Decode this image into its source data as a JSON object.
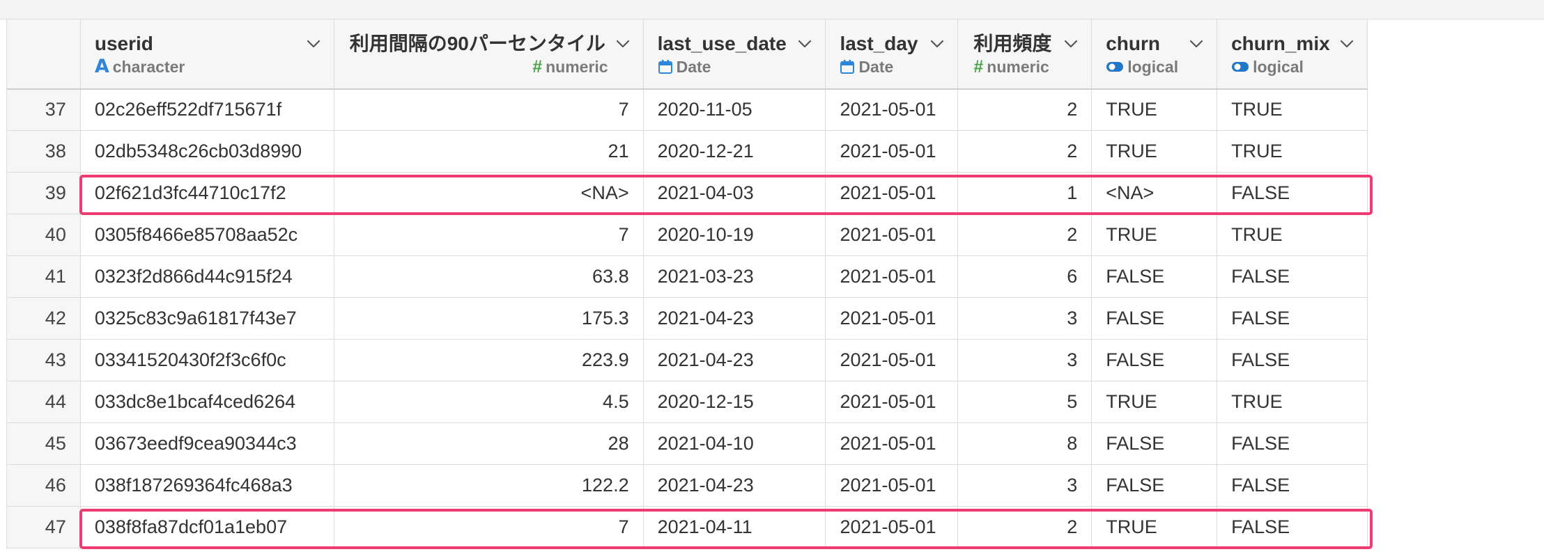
{
  "columns": [
    {
      "key": "rownum",
      "name": "",
      "type": ""
    },
    {
      "key": "userid",
      "name": "userid",
      "type": "character",
      "type_icon": "character-type-icon"
    },
    {
      "key": "interval_p90",
      "name": "利用間隔の90パーセンタイル",
      "type": "numeric",
      "type_icon": "numeric-type-icon"
    },
    {
      "key": "last_use_date",
      "name": "last_use_date",
      "type": "Date",
      "type_icon": "calendar-icon"
    },
    {
      "key": "last_day",
      "name": "last_day",
      "type": "Date",
      "type_icon": "calendar-icon"
    },
    {
      "key": "frequency",
      "name": "利用頻度",
      "type": "numeric",
      "type_icon": "numeric-type-icon"
    },
    {
      "key": "churn",
      "name": "churn",
      "type": "logical",
      "type_icon": "toggle-icon"
    },
    {
      "key": "churn_mix",
      "name": "churn_mix",
      "type": "logical",
      "type_icon": "toggle-icon"
    }
  ],
  "rows": [
    {
      "n": "37",
      "userid": "02c26eff522df715671f",
      "p90": "7",
      "last_use_date": "2020-11-05",
      "last_day": "2021-05-01",
      "freq": "2",
      "churn": "TRUE",
      "churn_mix": "TRUE"
    },
    {
      "n": "38",
      "userid": "02db5348c26cb03d8990",
      "p90": "21",
      "last_use_date": "2020-12-21",
      "last_day": "2021-05-01",
      "freq": "2",
      "churn": "TRUE",
      "churn_mix": "TRUE"
    },
    {
      "n": "39",
      "userid": "02f621d3fc44710c17f2",
      "p90": "<NA>",
      "last_use_date": "2021-04-03",
      "last_day": "2021-05-01",
      "freq": "1",
      "churn": "<NA>",
      "churn_mix": "FALSE"
    },
    {
      "n": "40",
      "userid": "0305f8466e85708aa52c",
      "p90": "7",
      "last_use_date": "2020-10-19",
      "last_day": "2021-05-01",
      "freq": "2",
      "churn": "TRUE",
      "churn_mix": "TRUE"
    },
    {
      "n": "41",
      "userid": "0323f2d866d44c915f24",
      "p90": "63.8",
      "last_use_date": "2021-03-23",
      "last_day": "2021-05-01",
      "freq": "6",
      "churn": "FALSE",
      "churn_mix": "FALSE"
    },
    {
      "n": "42",
      "userid": "0325c83c9a61817f43e7",
      "p90": "175.3",
      "last_use_date": "2021-04-23",
      "last_day": "2021-05-01",
      "freq": "3",
      "churn": "FALSE",
      "churn_mix": "FALSE"
    },
    {
      "n": "43",
      "userid": "03341520430f2f3c6f0c",
      "p90": "223.9",
      "last_use_date": "2021-04-23",
      "last_day": "2021-05-01",
      "freq": "3",
      "churn": "FALSE",
      "churn_mix": "FALSE"
    },
    {
      "n": "44",
      "userid": "033dc8e1bcaf4ced6264",
      "p90": "4.5",
      "last_use_date": "2020-12-15",
      "last_day": "2021-05-01",
      "freq": "5",
      "churn": "TRUE",
      "churn_mix": "TRUE"
    },
    {
      "n": "45",
      "userid": "03673eedf9cea90344c3",
      "p90": "28",
      "last_use_date": "2021-04-10",
      "last_day": "2021-05-01",
      "freq": "8",
      "churn": "FALSE",
      "churn_mix": "FALSE"
    },
    {
      "n": "46",
      "userid": "038f187269364fc468a3",
      "p90": "122.2",
      "last_use_date": "2021-04-23",
      "last_day": "2021-05-01",
      "freq": "3",
      "churn": "FALSE",
      "churn_mix": "FALSE"
    },
    {
      "n": "47",
      "userid": "038f8fa87dcf01a1eb07",
      "p90": "7",
      "last_use_date": "2021-04-11",
      "last_day": "2021-05-01",
      "freq": "2",
      "churn": "TRUE",
      "churn_mix": "FALSE"
    }
  ],
  "highlighted_rows": [
    "39",
    "47"
  ],
  "colors": {
    "highlight": "#ee3b72",
    "character_icon": "#2c86d9",
    "numeric_icon": "#4aa24a",
    "date_icon": "#2c86d9",
    "logical_icon": "#1f78c8",
    "na_text": "#a8a8a8"
  }
}
